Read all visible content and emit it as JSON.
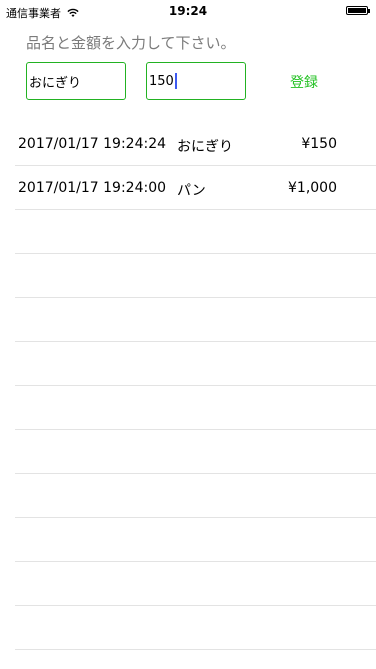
{
  "status_bar": {
    "carrier": "通信事業者",
    "time": "19:24",
    "icons": {
      "wifi": "wifi-icon",
      "battery": "battery-icon"
    },
    "battery_level": 1.0
  },
  "form": {
    "prompt": "品名と金額を入力して下さい。",
    "name_value": "おにぎり",
    "price_value": "150",
    "register_label": "登録",
    "accent_color": "#22b222"
  },
  "entries": [
    {
      "date": "2017/01/17 19:24:24",
      "name": "おにぎり",
      "price": "¥150"
    },
    {
      "date": "2017/01/17 19:24:00",
      "name": "パン",
      "price": "¥1,000"
    }
  ]
}
